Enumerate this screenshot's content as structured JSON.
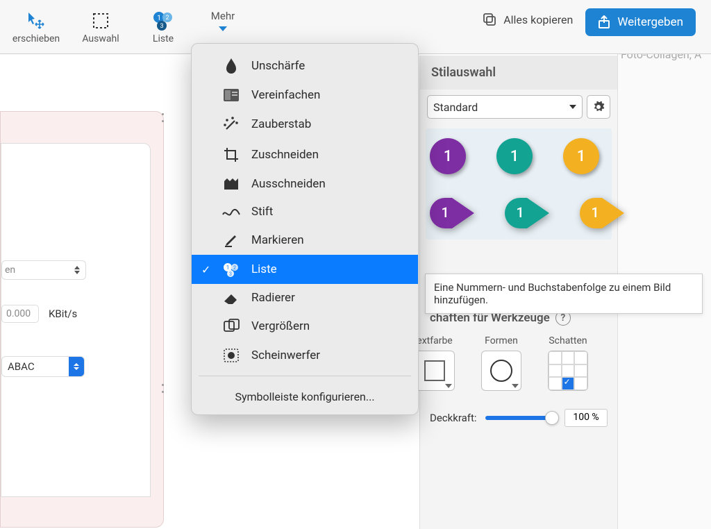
{
  "toolbar": {
    "move": "erschieben",
    "selection": "Auswahl",
    "list": "Liste",
    "more": "Mehr",
    "copy_all": "Alles kopieren",
    "share": "Weitergeben"
  },
  "background_app": {
    "label": "Foto-Collagen, A"
  },
  "left_panel": {
    "select_value": "en",
    "num_value": "0.000",
    "num_unit": "KBit/s",
    "seg_value": "ABAC"
  },
  "menu": {
    "items": [
      {
        "label": "Unschärfe",
        "icon": "blur"
      },
      {
        "label": "Vereinfachen",
        "icon": "simplify"
      },
      {
        "label": "Zauberstab",
        "icon": "wand"
      },
      {
        "label": "Zuschneiden",
        "icon": "crop"
      },
      {
        "label": "Ausschneiden",
        "icon": "cutout"
      },
      {
        "label": "Stift",
        "icon": "pen"
      },
      {
        "label": "Markieren",
        "icon": "highlight"
      },
      {
        "label": "Liste",
        "icon": "list",
        "selected": true
      },
      {
        "label": "Radierer",
        "icon": "eraser"
      },
      {
        "label": "Vergrößern",
        "icon": "magnify"
      },
      {
        "label": "Scheinwerfer",
        "icon": "spotlight"
      }
    ],
    "configure": "Symbolleiste konfigurieren..."
  },
  "right_panel": {
    "style_header": "Stilauswahl",
    "style_value": "Standard",
    "badge_number": "1",
    "tooltip": "Eine Nummern- und Buchstabenfolge zu einem Bild hinzufügen.",
    "tools_header": "chaften für Werkzeuge",
    "props": {
      "textcolor": "extfarbe",
      "shapes": "Formen",
      "shadow": "Schatten"
    },
    "opacity_label": "Deckkraft:",
    "opacity_value": "100 %"
  },
  "colors": {
    "purple": "#7e2ea3",
    "teal": "#12a393",
    "gold": "#f3b020",
    "accent": "#1f83d4"
  }
}
